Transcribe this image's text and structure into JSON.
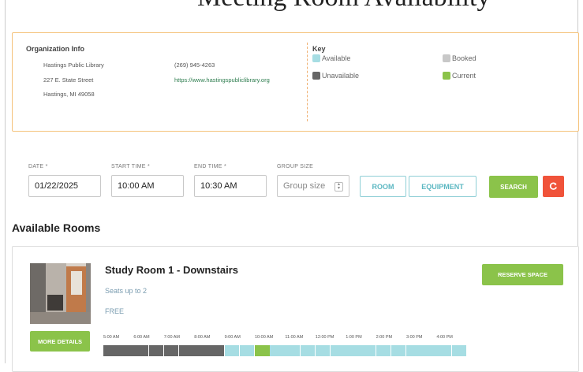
{
  "page": {
    "title_partial": "...g ... y"
  },
  "org_info": {
    "heading": "Organization Info",
    "name": "Hastings Public Library",
    "street": "227 E. State Street",
    "city": "Hastings, MI 49058",
    "phone": "(269) 945-4263",
    "website": "https://www.hastingspubliclibrary.org"
  },
  "key": {
    "heading": "Key",
    "items": [
      {
        "label": "Available",
        "color": "#a6dde3"
      },
      {
        "label": "Booked",
        "color": "#c8c8c8"
      },
      {
        "label": "Unavailable",
        "color": "#666666"
      },
      {
        "label": "Current",
        "color": "#8bc34a"
      }
    ]
  },
  "search_form": {
    "date_label": "DATE *",
    "date_value": "01/22/2025",
    "start_label": "START TIME *",
    "start_value": "10:00 AM",
    "end_label": "END TIME *",
    "end_value": "10:30 AM",
    "group_label": "GROUP SIZE",
    "group_placeholder": "Group size",
    "room_button": "ROOM",
    "equipment_button": "EQUIPMENT",
    "search_button": "SEARCH",
    "reset_icon": "refresh-icon"
  },
  "section": {
    "heading": "Available Rooms"
  },
  "room": {
    "name": "Study Room 1 - Downstairs",
    "seats": "Seats up to 2",
    "price": "FREE",
    "reserve_button": "RESERVE SPACE",
    "details_button": "MORE DETAILS",
    "time_labels": [
      "5:00 AM",
      "6:00 AM",
      "7:00 AM",
      "8:00 AM",
      "9:00 AM",
      "10:00 AM",
      "11:00 AM",
      "12:00 PM",
      "1:00 PM",
      "2:00 PM",
      "3:00 PM",
      "4:00 PM"
    ],
    "slots": [
      "unavailable",
      "unavailable",
      "unavailable",
      "unavailable",
      "unavailable",
      "unavailable",
      "unavailable",
      "unavailable",
      "available",
      "available",
      "current",
      "available",
      "available",
      "available",
      "available",
      "available",
      "available",
      "available",
      "available",
      "available",
      "available",
      "available",
      "available",
      "available"
    ]
  }
}
